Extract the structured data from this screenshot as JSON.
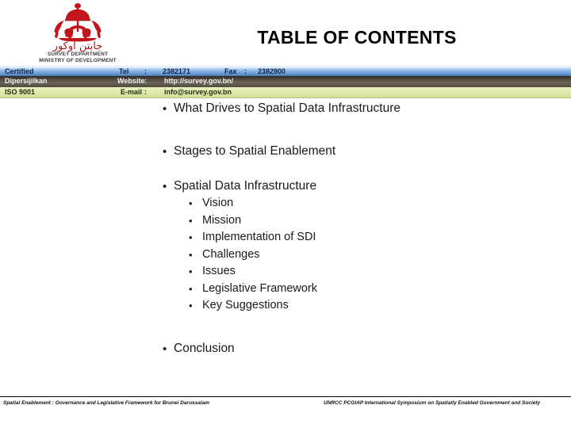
{
  "header": {
    "title": "TABLE OF CONTENTS",
    "logo": {
      "icon": "brunei-coat-of-arms",
      "jawi_text": "جابتن اوکور",
      "department_line1": "SURVEY DEPARTMENT",
      "department_line2": "MINISTRY OF DEVELOPMENT"
    }
  },
  "contact": {
    "rows": [
      {
        "label": "Certified",
        "key": "Tel",
        "colon": ":",
        "value": "2382171",
        "key2": "Fax",
        "colon2": ":",
        "value2": "2382900"
      },
      {
        "label": "Dipersijilkan",
        "key": "Website",
        "colon": ":",
        "value": "http://survey.gov.bn/"
      },
      {
        "label": "ISO 9001",
        "key": "E-mail",
        "colon": ":",
        "value": "info@survey.gov.bn"
      }
    ]
  },
  "toc": {
    "bullet_glyph": "•",
    "items": [
      {
        "level": 1,
        "text": "What Drives to Spatial Data Infrastructure"
      },
      {
        "level": 1,
        "text": "Stages to Spatial Enablement"
      },
      {
        "level": 1,
        "text": "Spatial Data Infrastructure"
      },
      {
        "level": 2,
        "text": "Vision"
      },
      {
        "level": 2,
        "text": "Mission"
      },
      {
        "level": 2,
        "text": "Implementation of SDI"
      },
      {
        "level": 2,
        "text": "Challenges"
      },
      {
        "level": 2,
        "text": "Issues"
      },
      {
        "level": 2,
        "text": "Legislative Framework"
      },
      {
        "level": 2,
        "text": "Key Suggestions"
      },
      {
        "level": 1,
        "text": "Conclusion"
      }
    ]
  },
  "footer": {
    "left": "Spatial Enablement : Governance and Legislative Framework for Brunei Darussalam",
    "right": "UNRCC PCGIAP International Symposium on Spatially Enabled Government and Society"
  },
  "colors": {
    "crest_red": "#b01317",
    "bar_blue": "#7ba9dc",
    "bar_brown": "#4c463c",
    "bar_green": "#e3ebb0",
    "text": "#1a1a1a"
  }
}
